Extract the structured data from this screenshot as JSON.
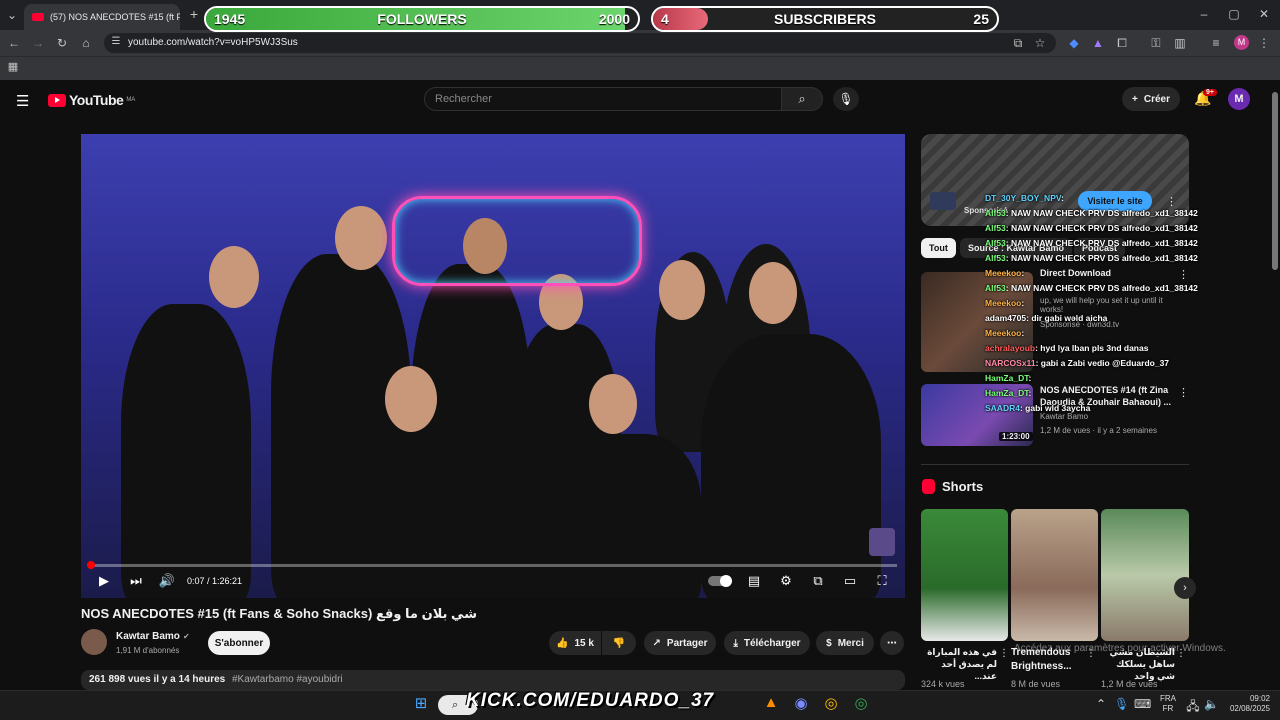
{
  "browser": {
    "tab_title": "(57) NOS ANECDOTES #15 (ft F",
    "url": "youtube.com/watch?v=voHP5WJ3Sus"
  },
  "overlay": {
    "followers_current": "1945",
    "followers_label": "FOLLOWERS",
    "followers_goal": "2000",
    "followers_progress": 0.97,
    "subs_current": "4",
    "subs_label": "SUBSCRIBERS",
    "subs_goal": "25",
    "subs_progress": 0.16
  },
  "youtube": {
    "logo": "YouTube",
    "country": "MA",
    "search_placeholder": "Rechercher",
    "create_label": "Créer",
    "notif_badge": "9+",
    "avatar_letter": "M"
  },
  "player": {
    "time": "0:07 / 1:26:21",
    "progress": 0.0014
  },
  "video": {
    "title": "NOS ANECDOTES #15 (ft Fans & Soho Snacks) شي بلان ما وقع",
    "channel": "Kawtar Bamo",
    "subscribers": "1,91 M d'abonnés",
    "subscribe": "S'abonner",
    "likes": "15 k",
    "share": "Partager",
    "download": "Télécharger",
    "thanks": "Merci",
    "views_date": "261 898 vues  il y a 14 heures",
    "hashtags": "#Kawtarbamo #ayoubidri"
  },
  "sidebar": {
    "ad_button": "Visiter le site",
    "ad_sponsored": "Sponsorisé",
    "chips": [
      "Tout",
      "Source : Kawtar Bamo",
      "Podcast"
    ],
    "rec1_title": "Direct Download",
    "rec1_desc": "up, we will help you set it up until it works!",
    "rec1_sponsor": "Sponsorisé · dwn3d.tv",
    "rec2_title": "NOS ANECDOTES #14 (ft Zina Daoudia & Zouhair Bahaoui) ...",
    "rec2_channel": "Kawtar Bamo",
    "rec2_meta": "1,2 M de vues · il y a 2 semaines",
    "rec2_duration": "1:23:00",
    "shorts_label": "Shorts",
    "shorts": [
      {
        "title": "في هذه المباراة لم يصدق أحد عند...",
        "views": "324 k vues"
      },
      {
        "title": "Tremendous Brightness...",
        "views": "8 M de vues"
      },
      {
        "title": "الشيطان مشي ساهل يسلكك شي واحد",
        "views": "1,2 M de vues"
      }
    ],
    "activate_windows": "Accédez aux paramètres pour activer Windows."
  },
  "chat": [
    {
      "user": "DT_30Y_BOY_NPV",
      "msg": ":",
      "color": "#5fd3ff"
    },
    {
      "user": "Alf53",
      "msg": ": NAW NAW CHECK PRV DS alfredo_xd1_38142",
      "color": "#7cff7c"
    },
    {
      "user": "Alf53",
      "msg": ": NAW NAW CHECK PRV DS alfredo_xd1_38142",
      "color": "#7cff7c"
    },
    {
      "user": "Alf53",
      "msg": ": NAW NAW CHECK PRV DS alfredo_xd1_38142",
      "color": "#7cff7c"
    },
    {
      "user": "Alf53",
      "msg": ": NAW NAW CHECK PRV DS alfredo_xd1_38142",
      "color": "#7cff7c"
    },
    {
      "user": "Meeekoo",
      "msg": ":",
      "color": "#ffb347"
    },
    {
      "user": "Alf53",
      "msg": ": NAW NAW CHECK PRV DS alfredo_xd1_38142",
      "color": "#7cff7c"
    },
    {
      "user": "Meeekoo",
      "msg": ":",
      "color": "#ffb347"
    },
    {
      "user": "adam4705",
      "msg": ": dir gabi wəld aicha",
      "color": "#ffffff"
    },
    {
      "user": "Meeekoo",
      "msg": ":",
      "color": "#ffb347"
    },
    {
      "user": "achralayoub",
      "msg": ": hyd lya lban pls 3nd danas",
      "color": "#ff5a5a"
    },
    {
      "user": "NARCOSx11",
      "msg": ": gabi a Zabi vedio @Eduardo_37",
      "color": "#ff8aa8"
    },
    {
      "user": "HamZa_DT",
      "msg": ":",
      "color": "#7cff7c"
    },
    {
      "user": "HamZa_DT",
      "msg": ":",
      "color": "#7cff7c"
    },
    {
      "user": "SAADR4",
      "msg": ": gabi wld 3aycha",
      "color": "#5fd3ff"
    }
  ],
  "taskbar": {
    "kick": "KICK.COM/EDUARDO_37",
    "lang1": "FRA",
    "lang2": "FR",
    "time": "09:02",
    "date": "02/08/2025"
  }
}
